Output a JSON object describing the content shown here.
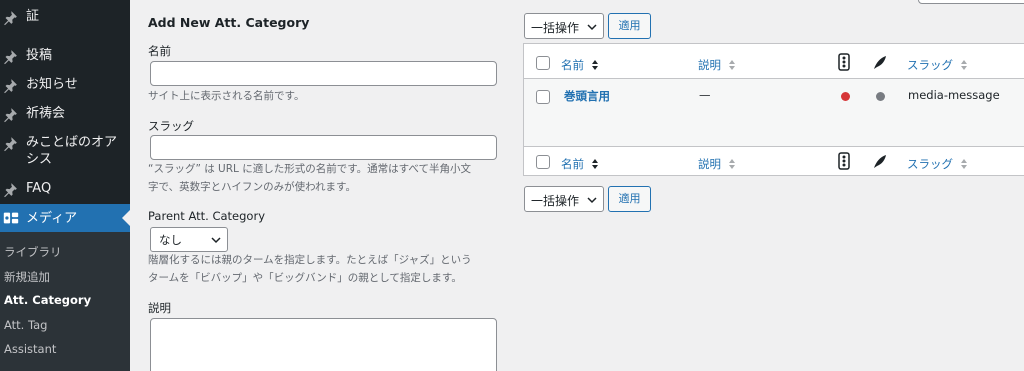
{
  "sidebar": {
    "items": [
      {
        "label": "証",
        "icon": "pin-icon"
      },
      {
        "label": "投稿",
        "icon": "pin-icon"
      },
      {
        "label": "お知らせ",
        "icon": "pin-icon"
      },
      {
        "label": "祈祷会",
        "icon": "pin-icon"
      },
      {
        "label": "みことばのオアシス",
        "icon": "pin-icon"
      },
      {
        "label": "FAQ",
        "icon": "pin-icon"
      }
    ],
    "active": {
      "label": "メディア",
      "icon": "media-icon"
    },
    "submenu": [
      "ライブラリ",
      "新規追加",
      "Att. Category",
      "Att. Tag",
      "Assistant"
    ],
    "submenu_current": "Att. Category",
    "colors": {
      "bg": "#1d2327",
      "active": "#2271b1",
      "sub_bg": "#2c3338"
    }
  },
  "form": {
    "title": "Add New Att. Category",
    "name_label": "名前",
    "name_value": "",
    "name_desc": "サイト上に表示される名前です。",
    "slug_label": "スラッグ",
    "slug_value": "",
    "slug_desc_1": "“スラッグ” は URL に適した形式の名前です。通常はすべて半角小文",
    "slug_desc_2": "字で、英数字とハイフンのみが使われます。",
    "parent_label": "Parent Att. Category",
    "parent_selected": "なし",
    "parent_desc_1": "階層化するには親のタームを指定します。たとえば「ジャズ」という",
    "parent_desc_2": "タームを「ビバップ」や「ビッグバンド」の親として指定します。",
    "description_label": "説明",
    "description_value": ""
  },
  "bulk": {
    "selected": "一括操作",
    "apply_label": "適用"
  },
  "table": {
    "headers": {
      "name": "名前",
      "description": "説明",
      "slug": "スラッグ"
    },
    "header_icons": [
      "traffic-light-icon",
      "feather-icon"
    ],
    "rows": [
      {
        "name": "巻頭言用",
        "description": "—",
        "status_color": "#d63638",
        "count_color": "#787c82",
        "slug": "media-message"
      }
    ]
  }
}
